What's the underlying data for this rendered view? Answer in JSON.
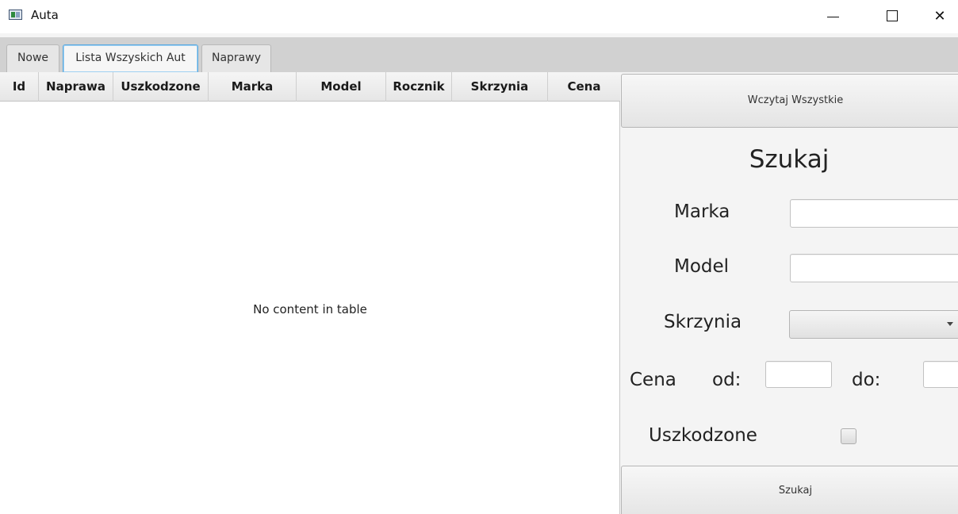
{
  "window": {
    "title": "Auta",
    "min_glyph": "—",
    "close_glyph": "✕"
  },
  "tabs": [
    {
      "label": "Nowe",
      "selected": false
    },
    {
      "label": "Lista Wszyskich Aut",
      "selected": true
    },
    {
      "label": "Naprawy",
      "selected": false
    }
  ],
  "table": {
    "columns": [
      "Id",
      "Naprawa",
      "Uszkodzone",
      "Marka",
      "Model",
      "Rocznik",
      "Skrzynia",
      "Cena"
    ],
    "rows": [],
    "empty_text": "No content in table"
  },
  "panel": {
    "load_all_label": "Wczytaj Wszystkie",
    "title": "Szukaj",
    "marka_label": "Marka",
    "marka_value": "",
    "model_label": "Model",
    "model_value": "",
    "skrzynia_label": "Skrzynia",
    "skrzynia_value": "",
    "cena_label": "Cena",
    "od_label": "od:",
    "od_value": "",
    "do_label": "do:",
    "do_value": "",
    "uszkodzone_label": "Uszkodzone",
    "uszkodzone_checked": false,
    "search_label": "Szukaj"
  },
  "colors": {
    "tab_selected_border": "#58a8df",
    "tab_bar": "#d1d1d1",
    "panel_bg": "#f4f4f4"
  }
}
